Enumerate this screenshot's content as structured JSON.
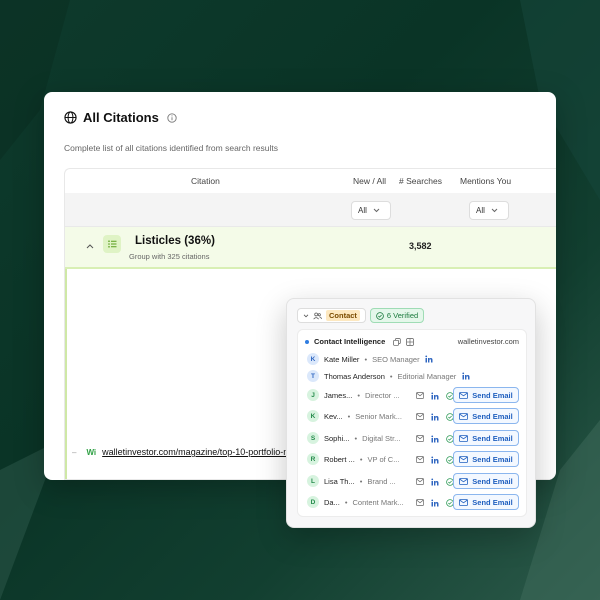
{
  "card": {
    "title": "All Citations",
    "subtitle": "Complete list of all citations identified from search results"
  },
  "table": {
    "columns": [
      "Citation",
      "New / All",
      "# Searches",
      "Mentions You"
    ],
    "filters": {
      "new_all": "All",
      "mentions": "All"
    },
    "group": {
      "title": "Listicles (36%)",
      "subtitle": "Group with 325 citations",
      "searches": "3,582"
    },
    "citation": {
      "logo": "Wi",
      "url": "walletinvestor.com/magazine/top-10-portfolio-m"
    }
  },
  "popover": {
    "contact_label": "Contact",
    "verified_label": "6 Verified",
    "section_title": "Contact Intelligence",
    "domain": "walletinvestor.com",
    "contacts": [
      {
        "initial": "K",
        "name": "Kate Miller",
        "role": "SEO Manager",
        "color": "blue",
        "verified": false
      },
      {
        "initial": "T",
        "name": "Thomas Anderson",
        "role": "Editorial Manager",
        "color": "blue",
        "verified": false
      },
      {
        "initial": "J",
        "name": "James...",
        "role": "Director ...",
        "color": "green",
        "verified": true
      },
      {
        "initial": "K",
        "name": "Kev...",
        "role": "Senior Mark...",
        "color": "green",
        "verified": true
      },
      {
        "initial": "S",
        "name": "Sophi...",
        "role": "Digital Str...",
        "color": "green",
        "verified": true
      },
      {
        "initial": "R",
        "name": "Robert ...",
        "role": "VP of C...",
        "color": "green",
        "verified": true
      },
      {
        "initial": "L",
        "name": "Lisa Th...",
        "role": "Brand ...",
        "color": "green",
        "verified": true
      },
      {
        "initial": "D",
        "name": "Da...",
        "role": "Content Mark...",
        "color": "green",
        "verified": true
      }
    ],
    "send_label": "Send Email"
  },
  "colors": {
    "bg": "#0e3a2c",
    "accent_green": "#cfe8a6",
    "link_blue": "#1f5fbf"
  }
}
